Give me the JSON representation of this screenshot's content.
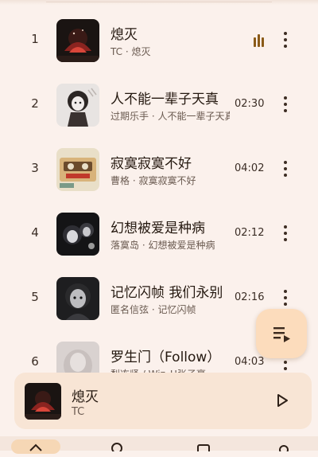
{
  "songs": [
    {
      "index": "1",
      "title": "熄灭",
      "subtitle": "TC · 熄灭",
      "duration": "",
      "playing": true
    },
    {
      "index": "2",
      "title": "人不能一辈子天真",
      "subtitle": "过期乐手 · 人不能一辈子天真",
      "duration": "02:30",
      "playing": false
    },
    {
      "index": "3",
      "title": "寂寞寂寞不好",
      "subtitle": "曹格 · 寂寞寂寞不好",
      "duration": "04:02",
      "playing": false
    },
    {
      "index": "4",
      "title": "幻想被爱是种病",
      "subtitle": "落寞岛 · 幻想被爱是种病",
      "duration": "02:12",
      "playing": false
    },
    {
      "index": "5",
      "title": "记忆闪帧 我们永别",
      "subtitle": "匿名信弦 · 记忆闪帧",
      "duration": "02:16",
      "playing": false
    },
    {
      "index": "6",
      "title": "罗生门（Follow）",
      "subtitle": "梨冻紧 / Wiz_H张子豪",
      "duration": "04:03",
      "playing": false
    }
  ],
  "now_playing": {
    "title": "熄灭",
    "artist": "TC"
  },
  "icons": {
    "playing": "equalizer-icon",
    "more": "more-vertical-icon",
    "queue": "queue-music-icon",
    "play": "play-icon"
  },
  "colors": {
    "background": "#fbf1ec",
    "accent": "#8a5a17",
    "fab": "#fcdcbc",
    "mini_player": "#f8e5d5"
  }
}
